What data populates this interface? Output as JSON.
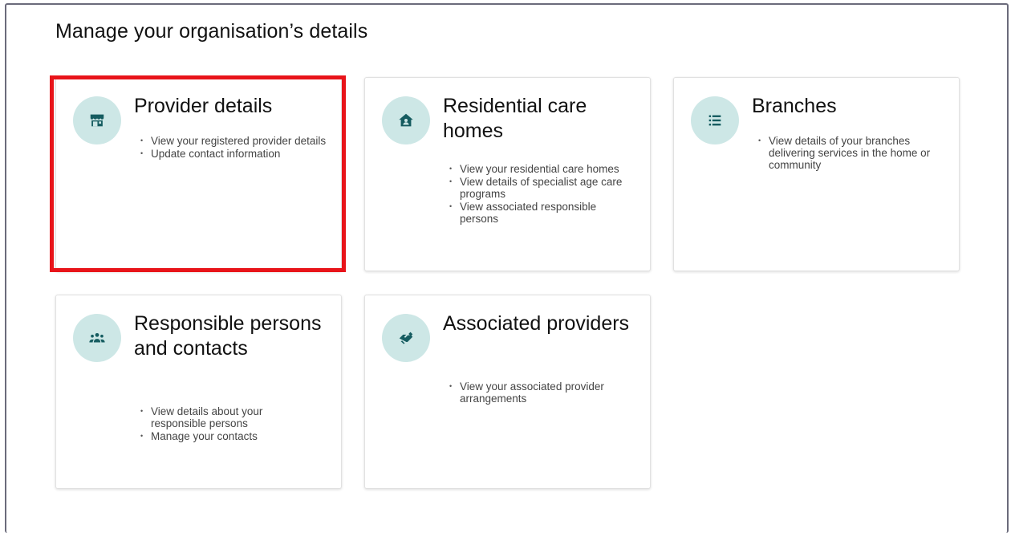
{
  "page": {
    "title": "Manage your organisation’s details"
  },
  "colors": {
    "icon_bg": "#cde7e6",
    "icon_fg": "#155c60",
    "highlight": "#e8141a",
    "frame": "#6b6b7b"
  },
  "cards": {
    "provider_details": {
      "icon": "storefront-icon",
      "title": "Provider details",
      "bullets": [
        "View your registered provider details",
        "Update contact information"
      ]
    },
    "residential_care_homes": {
      "icon": "home-icon",
      "title": "Residential care homes",
      "bullets": [
        "View your residential care homes",
        "View details of specialist age care programs",
        "View associated responsible persons"
      ]
    },
    "branches": {
      "icon": "list-icon",
      "title": "Branches",
      "bullets": [
        "View details of your branches delivering services in the home or community"
      ]
    },
    "responsible_persons": {
      "icon": "group-icon",
      "title": "Responsible persons and contacts",
      "bullets": [
        "View details about your responsible persons",
        "Manage your contacts"
      ]
    },
    "associated_providers": {
      "icon": "handshake-icon",
      "title": "Associated providers",
      "bullets": [
        "View your associated provider arrangements"
      ]
    }
  }
}
